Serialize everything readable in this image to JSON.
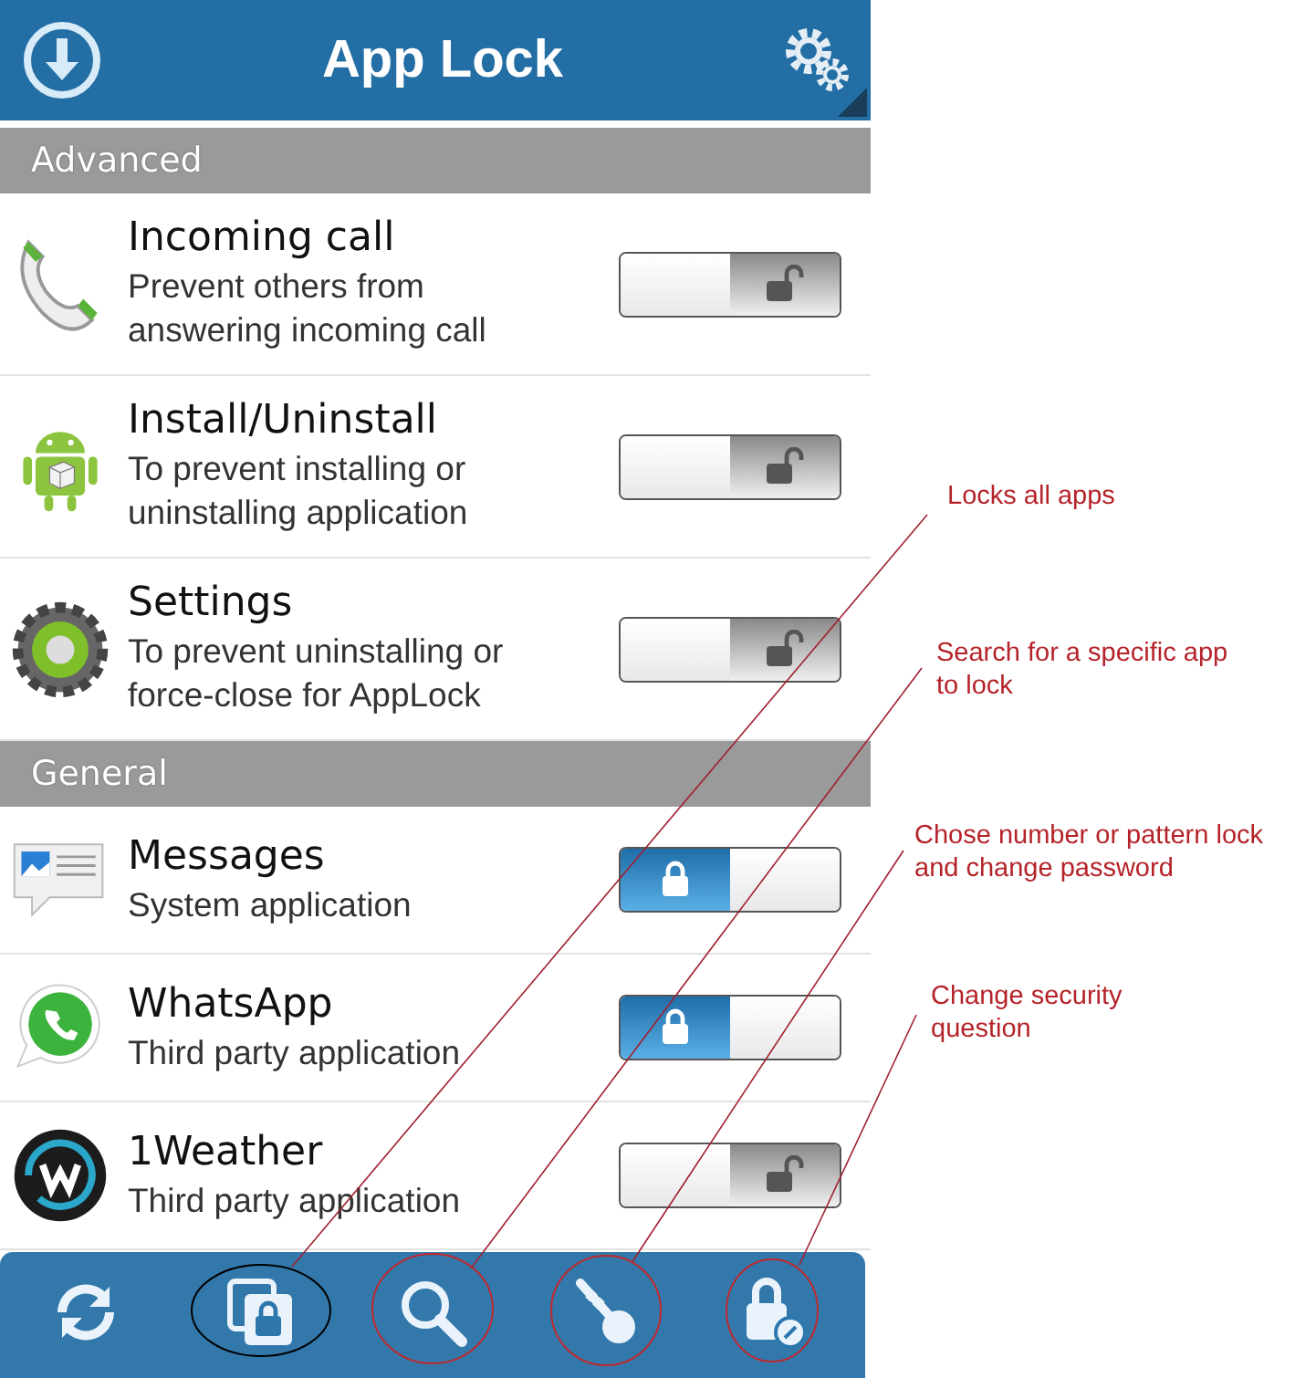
{
  "header": {
    "title": "App Lock"
  },
  "sections": [
    {
      "title": "Advanced",
      "items": [
        {
          "kind": "phone",
          "name": "Incoming call",
          "description": "Prevent others from answering incoming call",
          "locked": false
        },
        {
          "kind": "android",
          "name": "Install/Uninstall",
          "description": "To prevent installing or uninstalling application",
          "locked": false
        },
        {
          "kind": "gear",
          "name": "Settings",
          "description": "To prevent uninstalling or force-close for AppLock",
          "locked": false
        }
      ]
    },
    {
      "title": "General",
      "items": [
        {
          "kind": "messages",
          "name": "Messages",
          "description": "System application",
          "locked": true
        },
        {
          "kind": "chat",
          "name": "WhatsApp",
          "description": "Third party application",
          "locked": true
        },
        {
          "kind": "weather",
          "name": "1Weather",
          "description": "Third party application",
          "locked": false
        }
      ]
    }
  ],
  "toolbar": [
    {
      "kind": "refresh"
    },
    {
      "kind": "lock-all",
      "note": "Locks all apps",
      "color": "#000000"
    },
    {
      "kind": "search",
      "note": "Search for a specific app to lock",
      "color": "#c0282d"
    },
    {
      "kind": "key",
      "note": "Chose number or pattern lock and change password",
      "color": "#c0282d"
    },
    {
      "kind": "security",
      "note": "Change security question",
      "color": "#c0282d"
    }
  ]
}
